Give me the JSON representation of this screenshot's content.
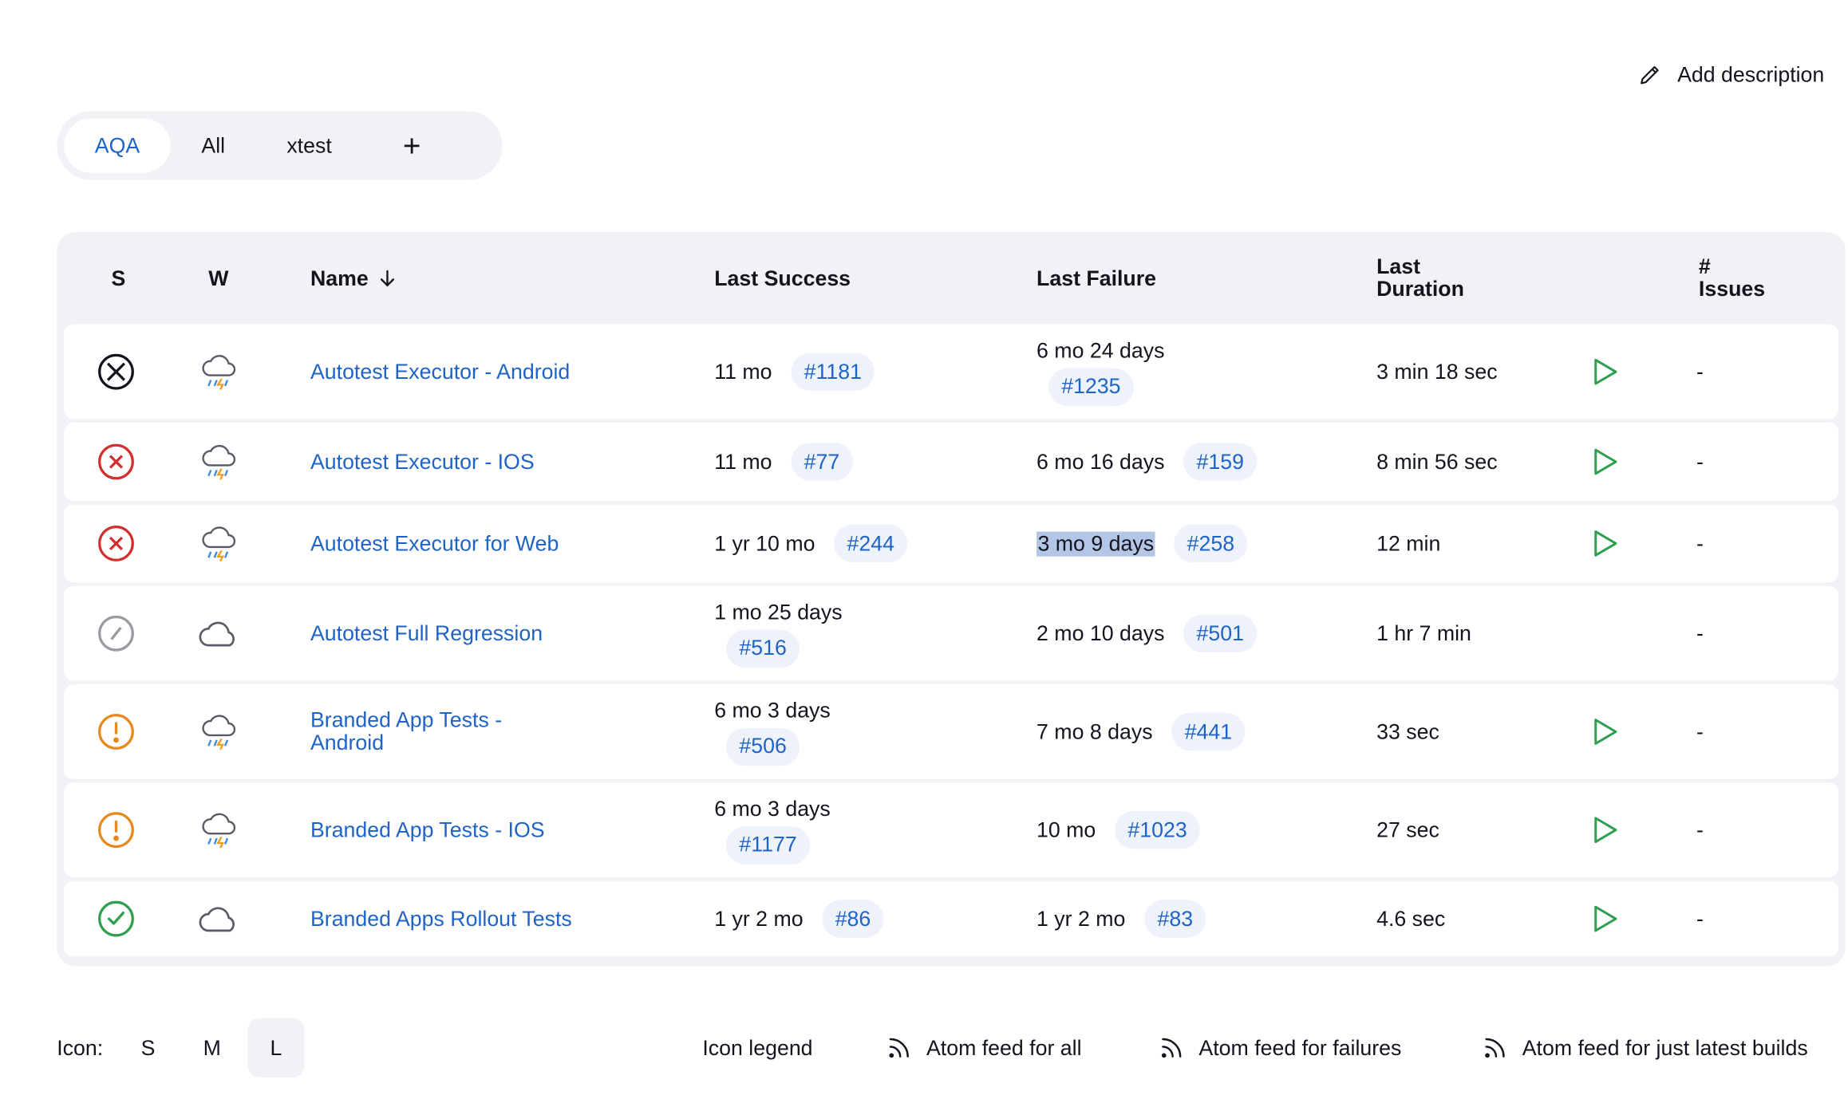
{
  "header": {
    "add_description": "Add description"
  },
  "tabs": [
    {
      "label": "AQA",
      "active": true
    },
    {
      "label": "All",
      "active": false
    },
    {
      "label": "xtest",
      "active": false
    },
    {
      "label": "+",
      "active": false
    }
  ],
  "table": {
    "columns": {
      "s": "S",
      "w": "W",
      "name": "Name",
      "last_success": "Last Success",
      "last_failure": "Last Failure",
      "last_duration_1": "Last",
      "last_duration_2": "Duration",
      "issues_1": "#",
      "issues_2": "Issues"
    },
    "sort_icon": "arrow-down-icon",
    "rows": [
      {
        "status": "aborted",
        "weather": "storm",
        "name": "Autotest Executor - Android",
        "success_time": "11 mo",
        "success_build": "#1181",
        "failure_time": "6 mo 24 days",
        "failure_build": "#1235",
        "duration": "3 min 18 sec",
        "issues": "-"
      },
      {
        "status": "failed",
        "weather": "storm",
        "name": "Autotest Executor - IOS",
        "success_time": "11 mo",
        "success_build": "#77",
        "failure_time": "6 mo 16 days",
        "failure_build": "#159",
        "duration": "8 min 56 sec",
        "issues": "-"
      },
      {
        "status": "failed",
        "weather": "storm",
        "name": "Autotest Executor for Web",
        "success_time": "1 yr 10 mo",
        "success_build": "#244",
        "failure_time": "3 mo 9 days",
        "failure_build": "#258",
        "duration": "12 min",
        "issues": "-"
      },
      {
        "status": "disabled",
        "weather": "cloudy",
        "name": "Autotest Full Regression",
        "success_time": "1 mo 25 days",
        "success_build": "#516",
        "failure_time": "2 mo 10 days",
        "failure_build": "#501",
        "duration": "1 hr 7 min",
        "issues": "-"
      },
      {
        "status": "unstable",
        "weather": "storm",
        "name_line1": "Branded App Tests -",
        "name_line2": "Android",
        "success_time": "6 mo 3 days",
        "success_build": "#506",
        "failure_time": "7 mo 8 days",
        "failure_build": "#441",
        "duration": "33 sec",
        "issues": "-"
      },
      {
        "status": "unstable",
        "weather": "storm",
        "name": "Branded App Tests - IOS",
        "success_time": "6 mo 3 days",
        "success_build": "#1177",
        "failure_time": "10 mo",
        "failure_build": "#1023",
        "duration": "27 sec",
        "issues": "-"
      },
      {
        "status": "success",
        "weather": "cloudy",
        "name": "Branded Apps Rollout Tests",
        "success_time": "1 yr 2 mo",
        "success_build": "#86",
        "failure_time": "1 yr 2 mo",
        "failure_build": "#83",
        "duration": "4.6 sec",
        "issues": "-"
      }
    ]
  },
  "footer": {
    "icon_label": "Icon:",
    "sizes": [
      "S",
      "M",
      "L"
    ],
    "active_size": "L",
    "icon_legend": "Icon legend",
    "feed_all": "Atom feed for all",
    "feed_failures": "Atom feed for failures",
    "feed_latest": "Atom feed for just latest builds"
  },
  "colors": {
    "link": "#1f63c7",
    "failed": "#d32f2f",
    "unstable": "#e8891d",
    "success": "#2e9e4f",
    "disabled": "#9a9aa3",
    "run": "#2e9e4f",
    "panel": "#f2f2f6"
  }
}
